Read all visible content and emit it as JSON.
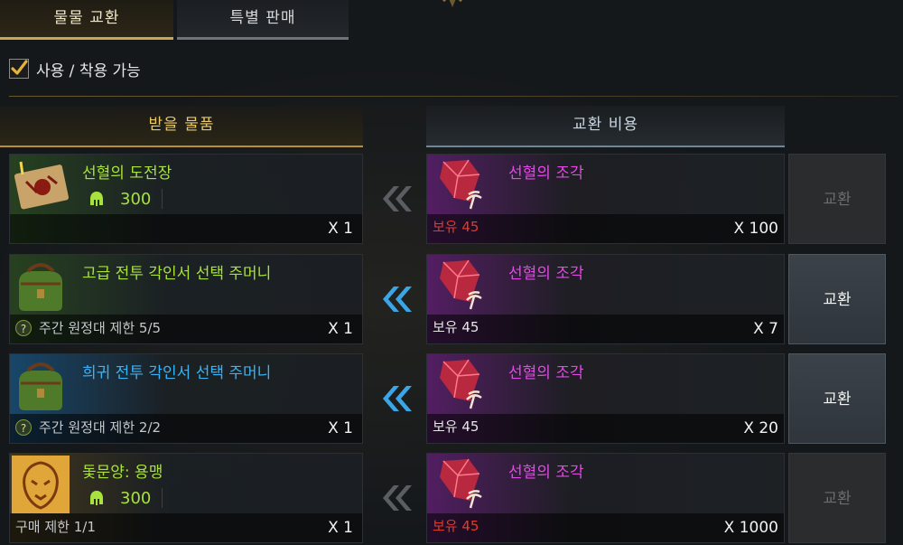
{
  "tabs": [
    {
      "label": "물물 교환",
      "active": true
    },
    {
      "label": "특별 판매",
      "active": false
    }
  ],
  "filter": {
    "label": "사용 / 착용 가능",
    "checked": true
  },
  "headers": {
    "receive": "받을 물품",
    "cost": "교환 비용"
  },
  "rows": [
    {
      "item_name": "선혈의 도전장",
      "item_icon": "map-scroll-icon",
      "price": "300",
      "limit": "",
      "quantity": "X 1",
      "arrow_active": false,
      "cost_name": "선혈의 조각",
      "owned": "보유 45",
      "owned_insufficient": true,
      "cost_quantity": "X 100",
      "button": "교환",
      "button_enabled": false
    },
    {
      "item_name": "고급 전투 각인서 선택 주머니",
      "item_icon": "green-bag-icon",
      "price": "",
      "limit": "주간 원정대 제한 5/5",
      "quantity": "X 1",
      "arrow_active": true,
      "cost_name": "선혈의 조각",
      "owned": "보유 45",
      "owned_insufficient": false,
      "cost_quantity": "X 7",
      "button": "교환",
      "button_enabled": true
    },
    {
      "item_name": "희귀 전투 각인서 선택 주머니",
      "item_icon": "green-bag-icon",
      "price": "",
      "limit": "주간 원정대 제한 2/2",
      "quantity": "X 1",
      "arrow_active": true,
      "cost_name": "선혈의 조각",
      "owned": "보유 45",
      "owned_insufficient": false,
      "cost_quantity": "X 20",
      "button": "교환",
      "button_enabled": true
    },
    {
      "item_name": "돛문양: 용맹",
      "item_icon": "tiger-emblem-icon",
      "price": "300",
      "limit": "구매 제한 1/1",
      "quantity": "X 1",
      "arrow_active": false,
      "cost_name": "선혈의 조각",
      "owned": "보유 45",
      "owned_insufficient": true,
      "cost_quantity": "X 1000",
      "button": "교환",
      "button_enabled": false
    }
  ],
  "colors": {
    "accent_gold": "#c9a554",
    "name_green": "#a8e23c",
    "name_blue": "#3cb2f2",
    "cost_purple": "#e24ae6",
    "insufficient_red": "#e23a2a",
    "arrow_active": "#3aa6e8",
    "arrow_inactive": "#5a5e62"
  }
}
